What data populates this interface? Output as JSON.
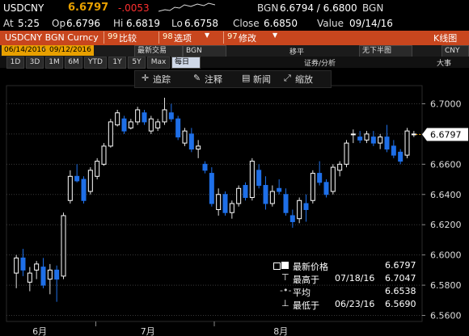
{
  "header": {
    "ticker": "USDCNY",
    "last": "6.6797",
    "change": "-.0053",
    "bid_label": "BGN",
    "bid_ask": "6.6794 / 6.6800",
    "source": "BGN",
    "at_label": "At",
    "at_time": "5:25",
    "open_label": "Op",
    "open": "6.6796",
    "hi_label": "Hi",
    "hi": "6.6819",
    "lo_label": "Lo",
    "lo": "6.6758",
    "close_label": "Close",
    "close": "6.6850",
    "value_label": "Value",
    "value_date": "09/14/16"
  },
  "function_bar": {
    "security": "USDCNY BGN Curncy",
    "btn_compare": "比较",
    "btn_compare_num": "99",
    "btn_options": "选项",
    "btn_options_num": "98",
    "btn_edit": "修改",
    "btn_edit_num": "97",
    "chart_type": "K线图"
  },
  "controls": {
    "start_date": "06/14/2016",
    "end_date": "09/12/2016",
    "last_trade": "最新交易",
    "source": "BGN",
    "moving_label": "移平",
    "no_area": "无下半图",
    "currency": "CNY",
    "zoom_label": "证券/分析",
    "size_label": "大事"
  },
  "periods": [
    "1D",
    "3D",
    "1M",
    "6M",
    "YTD",
    "1Y",
    "5Y",
    "Max"
  ],
  "period_freq": "每日",
  "toolbar": {
    "back": "追踪",
    "annotate": "注释",
    "news": "新闻",
    "zoom": "缩放"
  },
  "legend": {
    "last_label": "最新价格",
    "last_value": "6.6797",
    "high_label": "最高于",
    "high_date": "07/18/16",
    "high_value": "6.7047",
    "avg_label": "平均",
    "avg_value": "6.6538",
    "low_label": "最低于",
    "low_date": "06/23/16",
    "low_value": "6.5690"
  },
  "colors": {
    "up": "#ffffff",
    "down": "#1e6fe8",
    "change_red": "#ff3030",
    "last_orange": "#e8a000",
    "function_bar": "#c8461e"
  },
  "chart_data": {
    "type": "candlestick",
    "x_tick_labels": [
      "6月",
      "7月",
      "8月"
    ],
    "y_ticks": [
      6.56,
      6.58,
      6.6,
      6.62,
      6.64,
      6.66,
      6.68,
      6.7
    ],
    "ylim": [
      6.556,
      6.712
    ],
    "last_price_label": "6.6797",
    "candles": [
      {
        "o": 6.588,
        "h": 6.6,
        "l": 6.578,
        "c": 6.598
      },
      {
        "o": 6.598,
        "h": 6.604,
        "l": 6.586,
        "c": 6.59
      },
      {
        "o": 6.582,
        "h": 6.592,
        "l": 6.576,
        "c": 6.588
      },
      {
        "o": 6.59,
        "h": 6.596,
        "l": 6.584,
        "c": 6.594
      },
      {
        "o": 6.592,
        "h": 6.598,
        "l": 6.578,
        "c": 6.58
      },
      {
        "o": 6.584,
        "h": 6.594,
        "l": 6.574,
        "c": 6.59
      },
      {
        "o": 6.59,
        "h": 6.593,
        "l": 6.569,
        "c": 6.584
      },
      {
        "o": 6.586,
        "h": 6.628,
        "l": 6.584,
        "c": 6.626
      },
      {
        "o": 6.636,
        "h": 6.656,
        "l": 6.634,
        "c": 6.652
      },
      {
        "o": 6.652,
        "h": 6.66,
        "l": 6.648,
        "c": 6.649
      },
      {
        "o": 6.65,
        "h": 6.652,
        "l": 6.634,
        "c": 6.636
      },
      {
        "o": 6.642,
        "h": 6.658,
        "l": 6.64,
        "c": 6.656
      },
      {
        "o": 6.652,
        "h": 6.664,
        "l": 6.65,
        "c": 6.662
      },
      {
        "o": 6.66,
        "h": 6.674,
        "l": 6.659,
        "c": 6.672
      },
      {
        "o": 6.672,
        "h": 6.69,
        "l": 6.671,
        "c": 6.688
      },
      {
        "o": 6.686,
        "h": 6.696,
        "l": 6.685,
        "c": 6.694
      },
      {
        "o": 6.69,
        "h": 6.692,
        "l": 6.68,
        "c": 6.682
      },
      {
        "o": 6.684,
        "h": 6.69,
        "l": 6.683,
        "c": 6.688
      },
      {
        "o": 6.688,
        "h": 6.698,
        "l": 6.686,
        "c": 6.696
      },
      {
        "o": 6.694,
        "h": 6.696,
        "l": 6.686,
        "c": 6.688
      },
      {
        "o": 6.682,
        "h": 6.692,
        "l": 6.68,
        "c": 6.69
      },
      {
        "o": 6.684,
        "h": 6.69,
        "l": 6.682,
        "c": 6.688
      },
      {
        "o": 6.688,
        "h": 6.704,
        "l": 6.686,
        "c": 6.696
      },
      {
        "o": 6.694,
        "h": 6.7,
        "l": 6.688,
        "c": 6.69
      },
      {
        "o": 6.69,
        "h": 6.692,
        "l": 6.676,
        "c": 6.678
      },
      {
        "o": 6.674,
        "h": 6.684,
        "l": 6.672,
        "c": 6.682
      },
      {
        "o": 6.68,
        "h": 6.684,
        "l": 6.668,
        "c": 6.67
      },
      {
        "o": 6.67,
        "h": 6.676,
        "l": 6.664,
        "c": 6.672
      },
      {
        "o": 6.66,
        "h": 6.662,
        "l": 6.654,
        "c": 6.656
      },
      {
        "o": 6.654,
        "h": 6.658,
        "l": 6.632,
        "c": 6.634
      },
      {
        "o": 6.63,
        "h": 6.644,
        "l": 6.626,
        "c": 6.64
      },
      {
        "o": 6.64,
        "h": 6.642,
        "l": 6.626,
        "c": 6.628
      },
      {
        "o": 6.628,
        "h": 6.636,
        "l": 6.624,
        "c": 6.634
      },
      {
        "o": 6.634,
        "h": 6.646,
        "l": 6.632,
        "c": 6.644
      },
      {
        "o": 6.646,
        "h": 6.648,
        "l": 6.636,
        "c": 6.638
      },
      {
        "o": 6.638,
        "h": 6.664,
        "l": 6.636,
        "c": 6.662
      },
      {
        "o": 6.656,
        "h": 6.66,
        "l": 6.644,
        "c": 6.646
      },
      {
        "o": 6.646,
        "h": 6.652,
        "l": 6.63,
        "c": 6.634
      },
      {
        "o": 6.634,
        "h": 6.646,
        "l": 6.632,
        "c": 6.642
      },
      {
        "o": 6.644,
        "h": 6.65,
        "l": 6.64,
        "c": 6.642
      },
      {
        "o": 6.64,
        "h": 6.644,
        "l": 6.626,
        "c": 6.628
      },
      {
        "o": 6.626,
        "h": 6.63,
        "l": 6.618,
        "c": 6.622
      },
      {
        "o": 6.624,
        "h": 6.638,
        "l": 6.621,
        "c": 6.636
      },
      {
        "o": 6.634,
        "h": 6.64,
        "l": 6.622,
        "c": 6.63
      },
      {
        "o": 6.636,
        "h": 6.656,
        "l": 6.634,
        "c": 6.654
      },
      {
        "o": 6.654,
        "h": 6.662,
        "l": 6.646,
        "c": 6.648
      },
      {
        "o": 6.648,
        "h": 6.65,
        "l": 6.638,
        "c": 6.64
      },
      {
        "o": 6.642,
        "h": 6.66,
        "l": 6.64,
        "c": 6.658
      },
      {
        "o": 6.656,
        "h": 6.662,
        "l": 6.652,
        "c": 6.66
      },
      {
        "o": 6.66,
        "h": 6.676,
        "l": 6.658,
        "c": 6.674
      },
      {
        "o": 6.68,
        "h": 6.683,
        "l": 6.674,
        "c": 6.68
      },
      {
        "o": 6.678,
        "h": 6.682,
        "l": 6.674,
        "c": 6.676
      },
      {
        "o": 6.676,
        "h": 6.682,
        "l": 6.674,
        "c": 6.68
      },
      {
        "o": 6.678,
        "h": 6.682,
        "l": 6.672,
        "c": 6.674
      },
      {
        "o": 6.674,
        "h": 6.68,
        "l": 6.67,
        "c": 6.678
      },
      {
        "o": 6.678,
        "h": 6.686,
        "l": 6.668,
        "c": 6.67
      },
      {
        "o": 6.672,
        "h": 6.676,
        "l": 6.664,
        "c": 6.666
      },
      {
        "o": 6.668,
        "h": 6.67,
        "l": 6.66,
        "c": 6.662
      },
      {
        "o": 6.666,
        "h": 6.684,
        "l": 6.664,
        "c": 6.682
      },
      {
        "o": 6.68,
        "h": 6.682,
        "l": 6.678,
        "c": 6.68
      }
    ]
  }
}
